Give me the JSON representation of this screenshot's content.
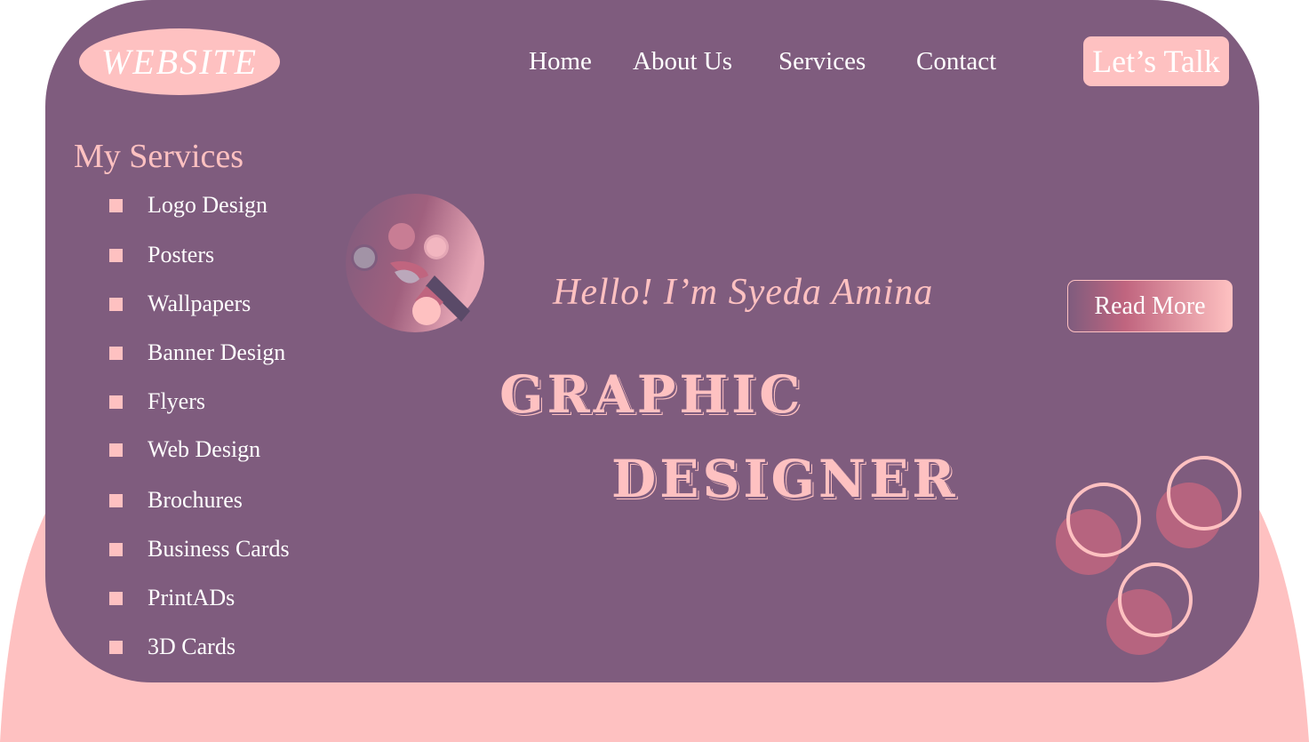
{
  "brand": {
    "logo_text": "WEBSITE"
  },
  "nav": {
    "home": "Home",
    "about": "About Us",
    "services": "Services",
    "contact": "Contact",
    "cta": "Let’s Talk"
  },
  "sidebar": {
    "title": "My Services",
    "items": [
      {
        "label": "Logo Design"
      },
      {
        "label": "Posters"
      },
      {
        "label": "Wallpapers"
      },
      {
        "label": "Banner Design"
      },
      {
        "label": "Flyers"
      },
      {
        "label": "Web Design"
      },
      {
        "label": "Brochures"
      },
      {
        "label": "Business Cards"
      },
      {
        "label": "PrintADs"
      },
      {
        "label": "3D Cards"
      }
    ]
  },
  "hero": {
    "greeting": "Hello! I’m Syeda Amina",
    "title_line1": "GRAPHIC",
    "title_line2": "DESIGNER",
    "read_more": "Read More"
  },
  "icons": {
    "palette": "paint-palette-icon",
    "bubbles": "decorative-circles"
  },
  "colors": {
    "panel": "#7f5c7e",
    "accent": "#fec1c1",
    "rose": "#c0657f",
    "text": "#ffffff"
  }
}
